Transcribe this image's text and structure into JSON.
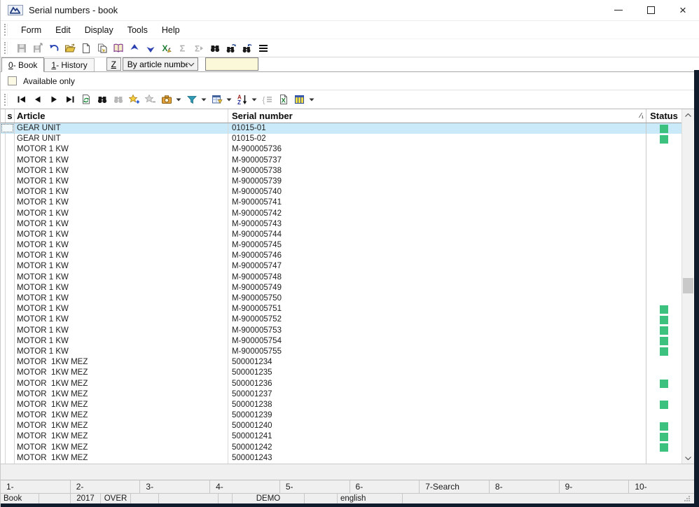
{
  "window": {
    "title": "Serial numbers - book"
  },
  "menu": {
    "items": [
      "Form",
      "Edit",
      "Display",
      "Tools",
      "Help"
    ]
  },
  "toolbar_main": {
    "icons": [
      "save-icon",
      "save-as-icon",
      "undo-icon",
      "open-icon",
      "new-document-icon",
      "copy-icon",
      "book-icon",
      "move-up-icon",
      "move-down-icon",
      "excel-edit-icon",
      "sum-icon",
      "sum-filtered-icon",
      "find-icon",
      "find-next-icon",
      "find-previous-icon",
      "menu-icon"
    ],
    "disabled": [
      "save-icon",
      "save-as-icon",
      "sum-icon",
      "sum-filtered-icon"
    ]
  },
  "tabs": {
    "items": [
      {
        "accel": "0",
        "rest": " - Book",
        "active": true
      },
      {
        "accel": "1",
        "rest": " - History",
        "active": false
      }
    ],
    "z_button": "Z",
    "filter_value": "By article number",
    "search_value": ""
  },
  "filters": {
    "available_only_label": "Available only",
    "available_only_checked": false
  },
  "toolbar_table": {
    "icons": [
      "first-record-icon",
      "previous-record-icon",
      "next-record-icon",
      "last-record-icon",
      "refresh-icon",
      "search-icon",
      "search-again-icon",
      "add-record-icon",
      "remove-record-icon",
      "snapshot-icon",
      "filter-icon",
      "form-view-icon",
      "sort-icon",
      "select-list-icon",
      "excel-export-icon",
      "grid-columns-icon"
    ],
    "disabled": [
      "search-again-icon",
      "remove-record-icon",
      "select-list-icon"
    ]
  },
  "table": {
    "columns": [
      {
        "label": "s"
      },
      {
        "label": "Article"
      },
      {
        "label": "Serial number"
      },
      {
        "label": "Status"
      }
    ],
    "sort_indicator": "⁄₁",
    "rows": [
      {
        "article": "GEAR UNIT",
        "serial": "01015-01",
        "status_green": true,
        "selected": true
      },
      {
        "article": "GEAR UNIT",
        "serial": "01015-02",
        "status_green": true
      },
      {
        "article": "MOTOR 1 KW",
        "serial": "M-900005736"
      },
      {
        "article": "MOTOR 1 KW",
        "serial": "M-900005737"
      },
      {
        "article": "MOTOR 1 KW",
        "serial": "M-900005738"
      },
      {
        "article": "MOTOR 1 KW",
        "serial": "M-900005739"
      },
      {
        "article": "MOTOR 1 KW",
        "serial": "M-900005740"
      },
      {
        "article": "MOTOR 1 KW",
        "serial": "M-900005741"
      },
      {
        "article": "MOTOR 1 KW",
        "serial": "M-900005742"
      },
      {
        "article": "MOTOR 1 KW",
        "serial": "M-900005743"
      },
      {
        "article": "MOTOR 1 KW",
        "serial": "M-900005744"
      },
      {
        "article": "MOTOR 1 KW",
        "serial": "M-900005745"
      },
      {
        "article": "MOTOR 1 KW",
        "serial": "M-900005746"
      },
      {
        "article": "MOTOR 1 KW",
        "serial": "M-900005747"
      },
      {
        "article": "MOTOR 1 KW",
        "serial": "M-900005748"
      },
      {
        "article": "MOTOR 1 KW",
        "serial": "M-900005749"
      },
      {
        "article": "MOTOR 1 KW",
        "serial": "M-900005750"
      },
      {
        "article": "MOTOR 1 KW",
        "serial": "M-900005751",
        "status_green": true
      },
      {
        "article": "MOTOR 1 KW",
        "serial": "M-900005752",
        "status_green": true
      },
      {
        "article": "MOTOR 1 KW",
        "serial": "M-900005753",
        "status_green": true
      },
      {
        "article": "MOTOR 1 KW",
        "serial": "M-900005754",
        "status_green": true
      },
      {
        "article": "MOTOR 1 KW",
        "serial": "M-900005755",
        "status_green": true
      },
      {
        "article": "MOTOR  1KW MEZ",
        "serial": "500001234"
      },
      {
        "article": "MOTOR  1KW MEZ",
        "serial": "500001235"
      },
      {
        "article": "MOTOR  1KW MEZ",
        "serial": "500001236",
        "status_green": true
      },
      {
        "article": "MOTOR  1KW MEZ",
        "serial": "500001237"
      },
      {
        "article": "MOTOR  1KW MEZ",
        "serial": "500001238",
        "status_green": true
      },
      {
        "article": "MOTOR  1KW MEZ",
        "serial": "500001239"
      },
      {
        "article": "MOTOR  1KW MEZ",
        "serial": "500001240",
        "status_green": true
      },
      {
        "article": "MOTOR  1KW MEZ",
        "serial": "500001241",
        "status_green": true
      },
      {
        "article": "MOTOR  1KW MEZ",
        "serial": "500001242",
        "status_green": true
      },
      {
        "article": "MOTOR  1KW MEZ",
        "serial": "500001243"
      }
    ]
  },
  "fkey_bar": {
    "items": [
      "1-",
      "2-",
      "3-",
      "4-",
      "5-",
      "6-",
      "7-Search",
      "8-",
      "9-",
      "10-"
    ]
  },
  "status_bar": {
    "cells": [
      "Book",
      "",
      "2017",
      "OVER",
      "",
      "",
      "",
      "DEMO",
      "",
      "english",
      ""
    ]
  },
  "colors": {
    "status_green": "#3cc17e",
    "selection_blue": "#cbeaf9",
    "input_yellow": "#fbf8da",
    "edge_dark": "#101b2c"
  }
}
